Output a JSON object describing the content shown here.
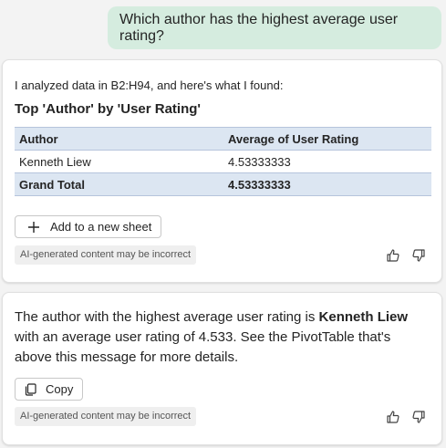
{
  "user_message": "Which author has the highest average user rating?",
  "response1": {
    "intro": "I analyzed data in B2:H94, and here's what I found:",
    "pivot_title": "Top 'Author' by 'User Rating'",
    "table": {
      "headers": [
        "Author",
        "Average of User Rating"
      ],
      "rows": [
        [
          "Kenneth Liew",
          "4.53333333"
        ]
      ],
      "total": [
        "Grand Total",
        "4.53333333"
      ]
    },
    "add_sheet_label": "Add to a new sheet",
    "disclaimer": "AI-generated content may be incorrect"
  },
  "response2": {
    "text_before": "The author with the highest average user rating is ",
    "author": "Kenneth Liew",
    "text_after": " with an average user rating of 4.533. See the PivotTable that's above this message for more details.",
    "copy_label": "Copy",
    "disclaimer": "AI-generated content may be incorrect"
  },
  "icons": {
    "add": "plus-icon",
    "copy": "copy-icon",
    "like": "thumbs-up-icon",
    "dislike": "thumbs-down-icon"
  }
}
